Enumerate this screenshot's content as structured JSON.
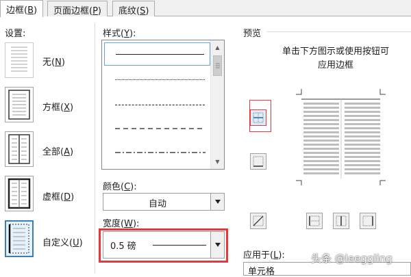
{
  "tabs": [
    {
      "label": "边框(",
      "hotkey": "B",
      "close": ")",
      "active": true
    },
    {
      "label": "页面边框(",
      "hotkey": "P",
      "close": ")",
      "active": false
    },
    {
      "label": "底纹(",
      "hotkey": "S",
      "close": ")",
      "active": false
    }
  ],
  "settings": {
    "heading": "设置:",
    "items": [
      {
        "label": "无(",
        "hotkey": "N",
        "close": ")",
        "icon": "setting-none-icon"
      },
      {
        "label": "方框(",
        "hotkey": "X",
        "close": ")",
        "icon": "setting-box-icon"
      },
      {
        "label": "全部(",
        "hotkey": "A",
        "close": ")",
        "icon": "setting-all-icon"
      },
      {
        "label": "虚框(",
        "hotkey": "D",
        "close": ")",
        "icon": "setting-grid-icon"
      },
      {
        "label": "自定义(",
        "hotkey": "U",
        "close": ")",
        "icon": "setting-custom-icon",
        "selected": true
      }
    ]
  },
  "style": {
    "heading": "样式(",
    "hotkey": "Y",
    "close": "):",
    "options": [
      "solid",
      "dotted",
      "dashed",
      "dash-spaced",
      "dash-dot"
    ],
    "selected_index": 0
  },
  "color": {
    "heading": "颜色(",
    "hotkey": "C",
    "close": "):",
    "value": "自动"
  },
  "width": {
    "heading": "宽度(",
    "hotkey": "W",
    "close": "):",
    "value": "0.5 磅"
  },
  "preview": {
    "heading": "预览",
    "hint_line1": "单击下方图示或使用按钮可",
    "hint_line2": "应用边框"
  },
  "apply_to": {
    "heading": "应用于(",
    "hotkey": "L",
    "close": "):",
    "value": "单元格"
  },
  "watermark": "头条 @leeggling",
  "colors": {
    "accent": "#3c7fb1",
    "highlight": "#e03a3e"
  }
}
